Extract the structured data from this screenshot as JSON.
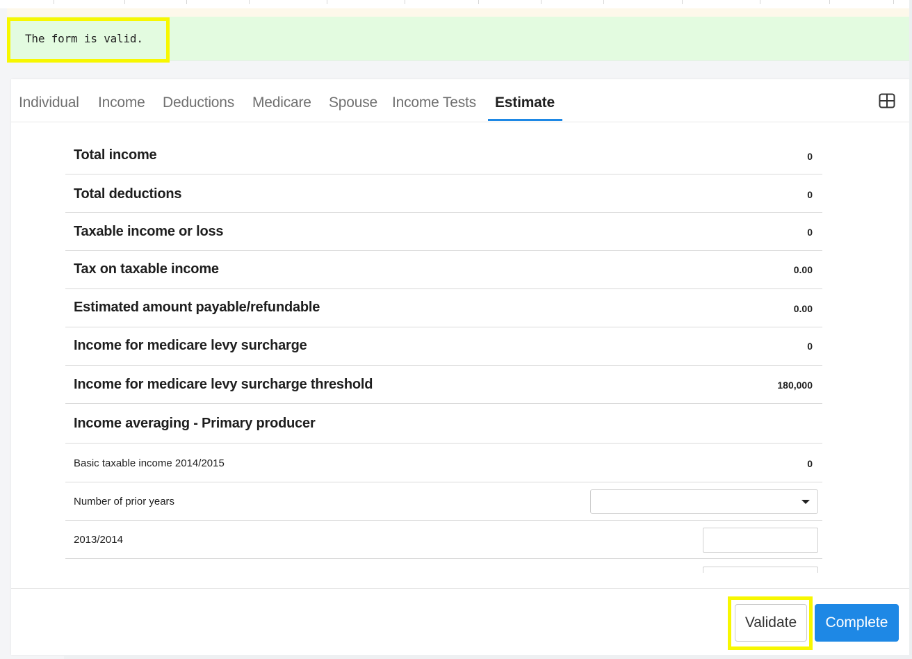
{
  "alert": {
    "message": "The form is valid."
  },
  "tabs": [
    {
      "label": "Individual",
      "active": false
    },
    {
      "label": "Income",
      "active": false
    },
    {
      "label": "Deductions",
      "active": false
    },
    {
      "label": "Medicare",
      "active": false
    },
    {
      "label": "Spouse",
      "active": false
    },
    {
      "label": "Income Tests",
      "active": false
    },
    {
      "label": "Estimate",
      "active": true
    }
  ],
  "toolbar": {
    "layout_icon": "grid-layout-icon"
  },
  "estimate": {
    "rows": [
      {
        "label": "Total income",
        "value": "0"
      },
      {
        "label": "Total deductions",
        "value": "0"
      },
      {
        "label": "Taxable income or loss",
        "value": "0"
      },
      {
        "label": "Tax on taxable income",
        "value": "0.00"
      },
      {
        "label": "Estimated amount payable/refundable",
        "value": "0.00"
      },
      {
        "label": "Income for medicare levy surcharge",
        "value": "0"
      },
      {
        "label": "Income for medicare levy surcharge threshold",
        "value": "180,000"
      }
    ],
    "averaging": {
      "heading": "Income averaging - Primary producer",
      "basic_label": "Basic taxable income 2014/2015",
      "basic_value": "0",
      "prior_years_label": "Number of prior years",
      "prior_years_value": "",
      "year_label": "2013/2014",
      "year_value": ""
    }
  },
  "footer": {
    "validate_label": "Validate",
    "complete_label": "Complete"
  },
  "colors": {
    "accent": "#1e88e5",
    "alert_bg": "#e3fbe0",
    "highlight": "#f7f700"
  }
}
